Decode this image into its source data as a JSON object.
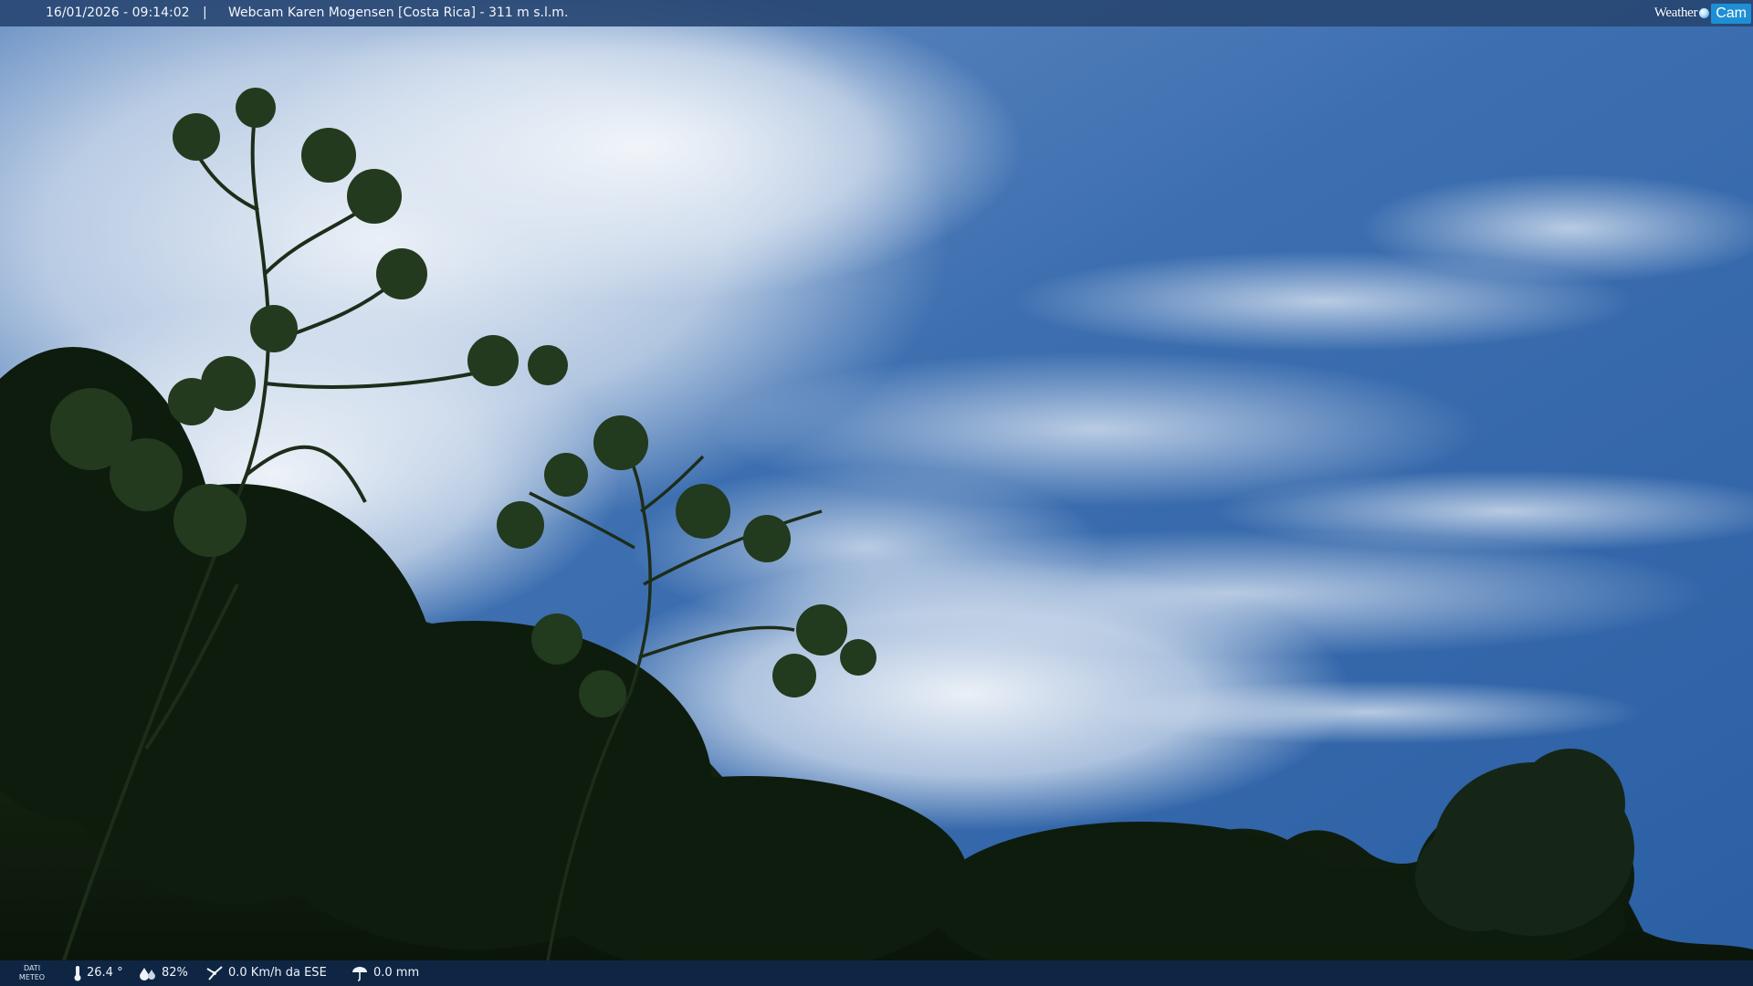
{
  "overlay": {
    "datetime": "16/01/2026 - 09:14:02",
    "separator": "|",
    "title": "Webcam Karen Mogensen [Costa Rica] - 311 m s.l.m.",
    "logo_text_1": "Weather",
    "logo_text_2": "Cam"
  },
  "meteo": {
    "label_line1": "DATI",
    "label_line2": "METEO",
    "temperature": "26.4 °",
    "humidity": "82%",
    "wind": "0.0 Km/h da ESE",
    "rain": "0.0 mm",
    "icons": {
      "temperature": "thermometer-icon",
      "humidity": "humidity-drop-icon",
      "wind": "wind-icon",
      "rain": "rain-icon"
    }
  },
  "colors": {
    "sky_top": "#2c5d9e",
    "sky_mid": "#4677b8",
    "cloud": "#e9eff6",
    "foliage_dark": "#0d1a0c",
    "foliage": "#22381a",
    "overlay_bar": "#284673",
    "logo_accent": "#1e8fd4"
  }
}
